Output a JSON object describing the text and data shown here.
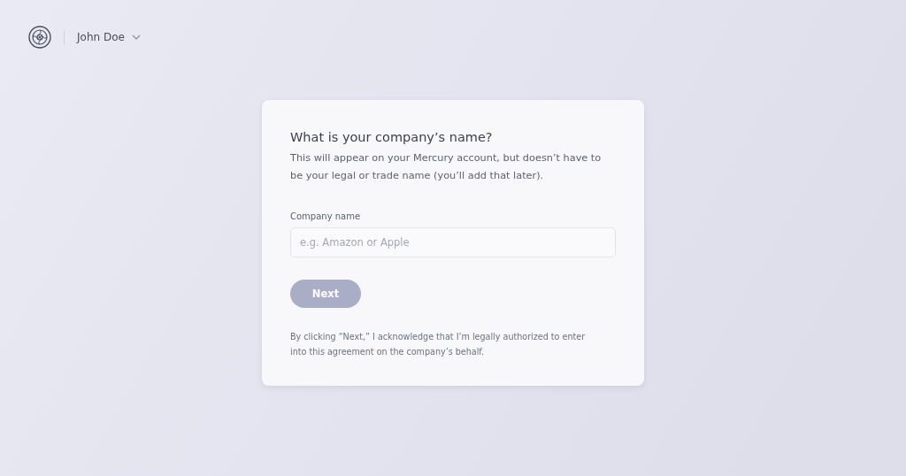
{
  "header": {
    "user_name": "John Doe"
  },
  "form": {
    "title": "What is your company’s name?",
    "description": "This will appear on your Mercury account, but doesn’t have to be your legal or trade name (you’ll add that later).",
    "field": {
      "label": "Company name",
      "placeholder": "e.g. Amazon or Apple"
    },
    "next_button": {
      "label": "Next",
      "disabled": true
    },
    "disclaimer": "By clicking “Next,” I acknowledge that I’m legally authorized to enter into this agreement on the company’s behalf."
  }
}
